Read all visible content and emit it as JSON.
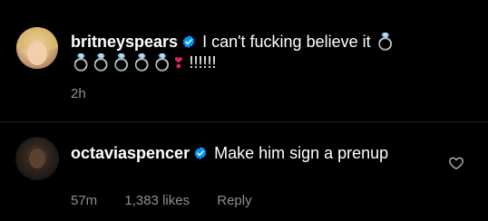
{
  "comments": [
    {
      "username": "britneyspears",
      "text": "I can't fucking believe it",
      "rings_after_text": "💍",
      "rings_line2": "💍💍💍💍💍",
      "emphasis": "❣",
      "exclaims": "!!!!!!",
      "time": "2h"
    },
    {
      "username": "octaviaspencer",
      "text": "Make him sign a prenup",
      "time": "57m",
      "likes": "1,383 likes",
      "reply": "Reply"
    }
  ],
  "icons": {
    "verified": "verified-badge-icon",
    "like": "heart-outline-icon"
  },
  "colors": {
    "background": "#000000",
    "verified": "#0095f6",
    "meta": "#8e8e8e",
    "divider": "#262626"
  }
}
